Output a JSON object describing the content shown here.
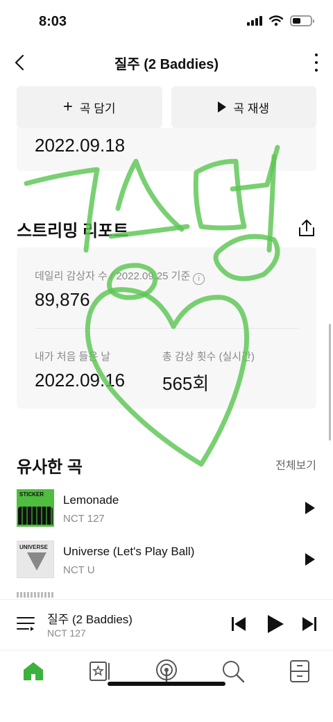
{
  "status": {
    "time": "8:03",
    "battery_level": 0.45
  },
  "nav": {
    "title": "질주 (2 Baddies)"
  },
  "actions": {
    "add_label": "곡 담기",
    "play_label": "곡 재생"
  },
  "release_date": "2022.09.18",
  "report": {
    "heading": "스트리밍 리포트",
    "daily_label": "데일리 감상자 수 / 2022.09.25 기준",
    "daily_value": "89,876",
    "first_label": "내가 처음 들은 날",
    "first_value": "2022.09.16",
    "total_label": "총 감상 횟수 (실시간)",
    "total_value": "565회"
  },
  "similar": {
    "heading": "유사한 곡",
    "view_all": "전체보기",
    "songs": [
      {
        "title": "Lemonade",
        "artist": "NCT 127",
        "cover_text": "STICKER"
      },
      {
        "title": "Universe (Let's Play Ball)",
        "artist": "NCT U",
        "cover_text": "UNIVERSE"
      }
    ]
  },
  "player": {
    "title": "질주 (2 Baddies)",
    "artist": "NCT 127"
  },
  "tabs": [
    "home-icon",
    "library-icon",
    "podcast-icon",
    "search-icon",
    "storage-icon"
  ],
  "colors": {
    "accent": "#3cb13c",
    "handwriting": "#5cc653"
  }
}
